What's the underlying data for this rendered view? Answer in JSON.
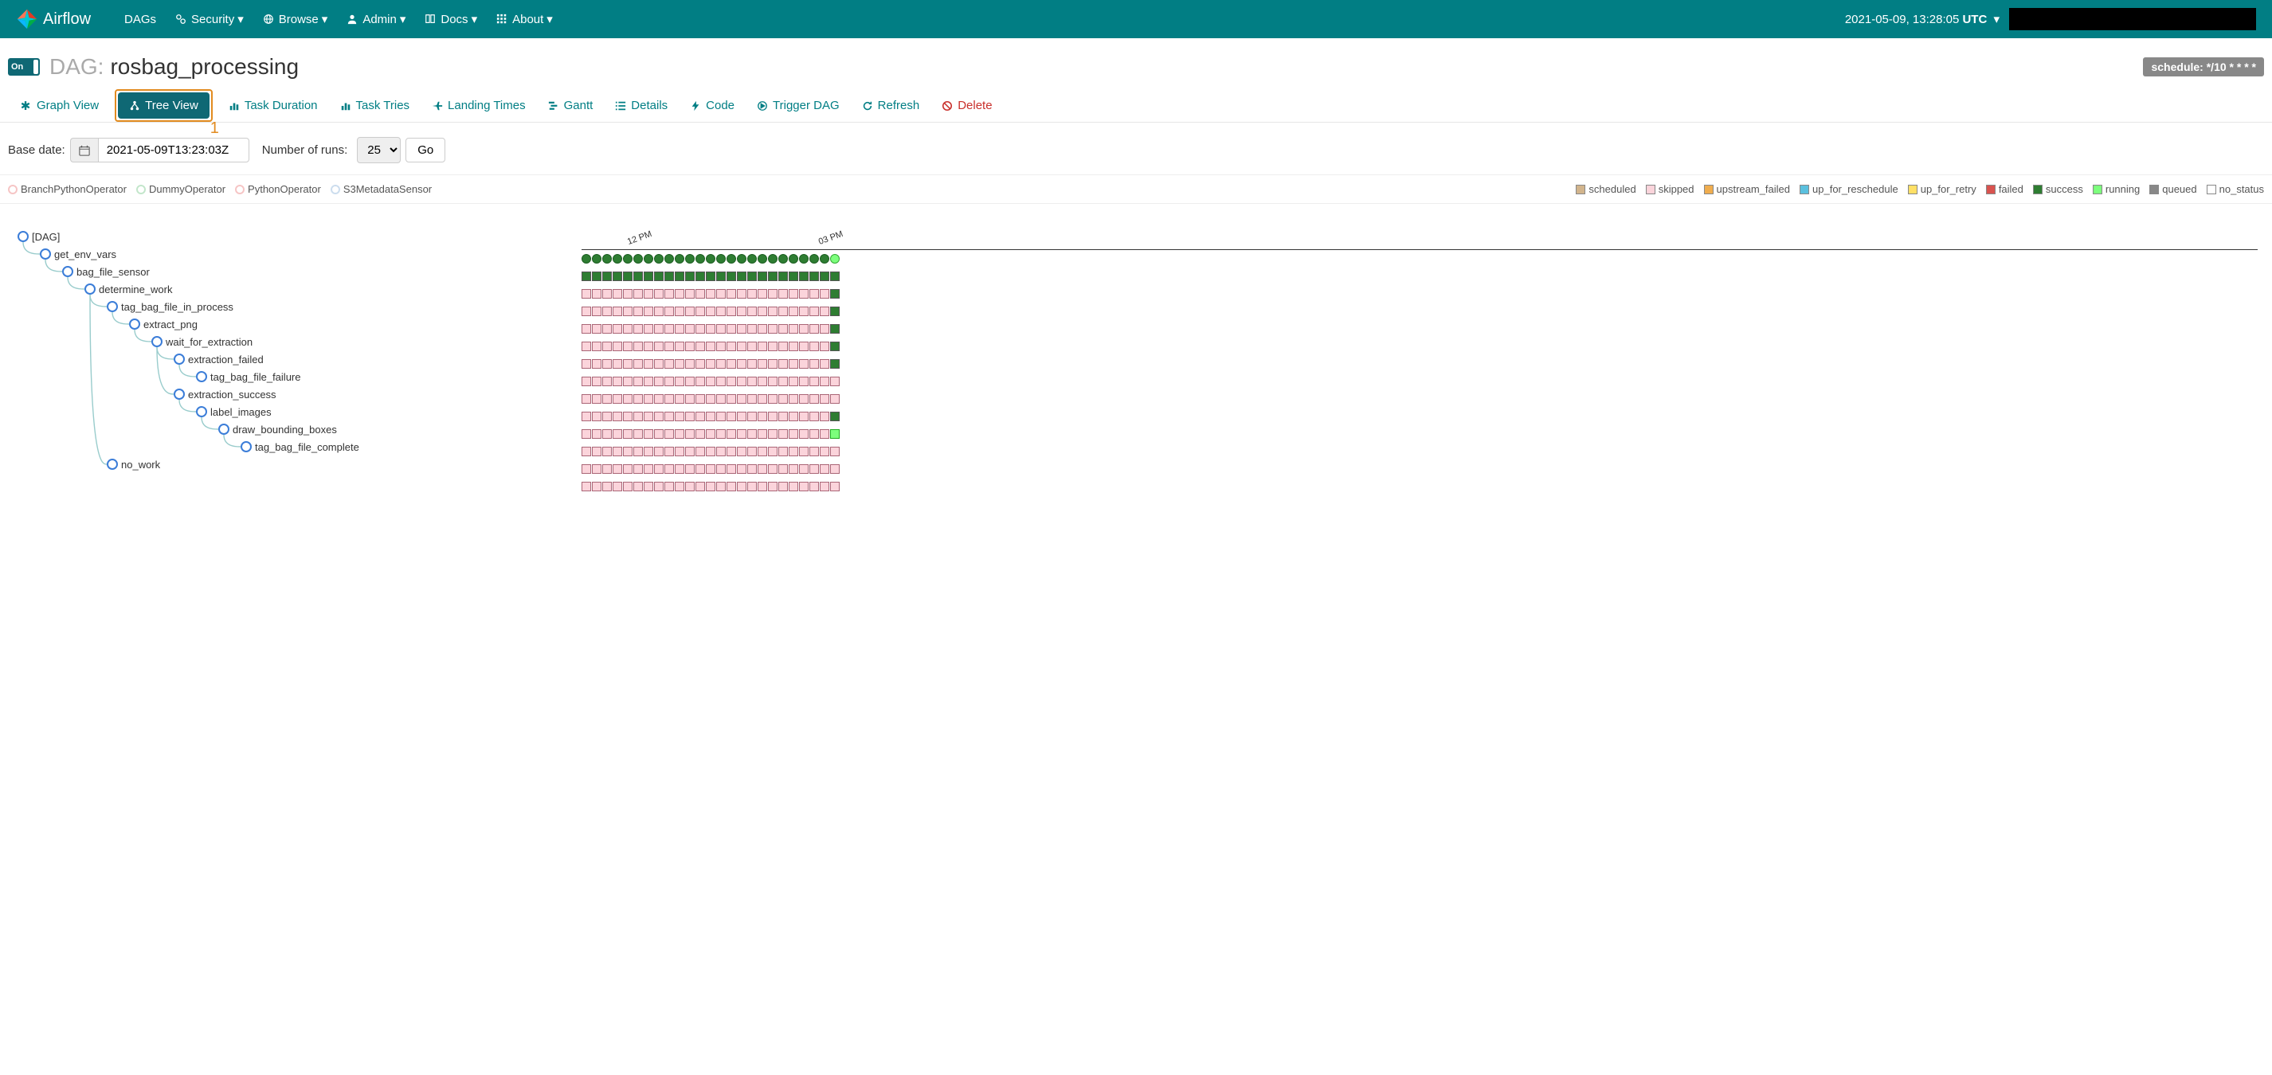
{
  "navbar": {
    "brand": "Airflow",
    "items": [
      {
        "label": "DAGs",
        "icon": null,
        "dropdown": false
      },
      {
        "label": "Security",
        "icon": "gears",
        "dropdown": true
      },
      {
        "label": "Browse",
        "icon": "globe",
        "dropdown": true
      },
      {
        "label": "Admin",
        "icon": "user",
        "dropdown": true
      },
      {
        "label": "Docs",
        "icon": "book",
        "dropdown": true
      },
      {
        "label": "About",
        "icon": "grid",
        "dropdown": true
      }
    ],
    "datetime": "2021-05-09, 13:28:05",
    "tz": "UTC"
  },
  "header": {
    "toggle_label": "On",
    "dag_label": "DAG:",
    "dag_name": "rosbag_processing",
    "schedule_label": "schedule: */10 * * * *"
  },
  "tabs": [
    {
      "key": "graph",
      "label": "Graph View",
      "icon": "✱",
      "active": false
    },
    {
      "key": "tree",
      "label": "Tree View",
      "icon": "tree",
      "active": true,
      "highlighted": true,
      "highlight_num": "1"
    },
    {
      "key": "duration",
      "label": "Task Duration",
      "icon": "bars",
      "active": false
    },
    {
      "key": "tries",
      "label": "Task Tries",
      "icon": "bars",
      "active": false
    },
    {
      "key": "landing",
      "label": "Landing Times",
      "icon": "plane",
      "active": false
    },
    {
      "key": "gantt",
      "label": "Gantt",
      "icon": "gantt",
      "active": false
    },
    {
      "key": "details",
      "label": "Details",
      "icon": "list",
      "active": false
    },
    {
      "key": "code",
      "label": "Code",
      "icon": "bolt",
      "active": false
    },
    {
      "key": "trigger",
      "label": "Trigger DAG",
      "icon": "play",
      "active": false
    },
    {
      "key": "refresh",
      "label": "Refresh",
      "icon": "refresh",
      "active": false
    },
    {
      "key": "delete",
      "label": "Delete",
      "icon": "ban",
      "active": false,
      "danger": true
    }
  ],
  "controls": {
    "base_date_label": "Base date:",
    "base_date_value": "2021-05-09T13:23:03Z",
    "num_runs_label": "Number of runs:",
    "num_runs_value": "25",
    "go_label": "Go"
  },
  "operator_legend": [
    {
      "name": "BranchPythonOperator",
      "color": "#f6c5c5"
    },
    {
      "name": "DummyOperator",
      "color": "#c3e6cb"
    },
    {
      "name": "PythonOperator",
      "color": "#f6c5c5"
    },
    {
      "name": "S3MetadataSensor",
      "color": "#cde"
    }
  ],
  "status_legend": [
    {
      "name": "scheduled",
      "color": "#d2b48c"
    },
    {
      "name": "skipped",
      "color": "#fbd4db"
    },
    {
      "name": "upstream_failed",
      "color": "#f0ad4e"
    },
    {
      "name": "up_for_reschedule",
      "color": "#5bc0de"
    },
    {
      "name": "up_for_retry",
      "color": "#ffe066"
    },
    {
      "name": "failed",
      "color": "#d9534f"
    },
    {
      "name": "success",
      "color": "#2e7d32"
    },
    {
      "name": "running",
      "color": "#7dff7d"
    },
    {
      "name": "queued",
      "color": "#888"
    },
    {
      "name": "no_status",
      "color": "#fff"
    }
  ],
  "tree": [
    {
      "name": "[DAG]",
      "depth": 0
    },
    {
      "name": "get_env_vars",
      "depth": 1
    },
    {
      "name": "bag_file_sensor",
      "depth": 2
    },
    {
      "name": "determine_work",
      "depth": 3
    },
    {
      "name": "tag_bag_file_in_process",
      "depth": 4
    },
    {
      "name": "extract_png",
      "depth": 5
    },
    {
      "name": "wait_for_extraction",
      "depth": 6
    },
    {
      "name": "extraction_failed",
      "depth": 7
    },
    {
      "name": "tag_bag_file_failure",
      "depth": 8
    },
    {
      "name": "extraction_success",
      "depth": 7
    },
    {
      "name": "label_images",
      "depth": 8
    },
    {
      "name": "draw_bounding_boxes",
      "depth": 9
    },
    {
      "name": "tag_bag_file_complete",
      "depth": 10
    },
    {
      "name": "no_work",
      "depth": 4
    }
  ],
  "timeline": {
    "ticks": [
      "12 PM",
      "03 PM"
    ],
    "num_runs": 25,
    "dag_row_last_running": true,
    "task_rows": [
      {
        "pattern": "all_success_last_success"
      },
      {
        "pattern": "all_skipped_last_success"
      },
      {
        "pattern": "all_skipped_last_success"
      },
      {
        "pattern": "all_skipped_last_success"
      },
      {
        "pattern": "all_skipped_last_success"
      },
      {
        "pattern": "all_skipped_last_success"
      },
      {
        "pattern": "all_skipped_last_skipped"
      },
      {
        "pattern": "all_skipped_last_skipped"
      },
      {
        "pattern": "all_skipped_last_success"
      },
      {
        "pattern": "all_skipped_last_running"
      },
      {
        "pattern": "all_skipped_last_skipped"
      },
      {
        "pattern": "all_skipped_last_skipped"
      },
      {
        "pattern": "all_skipped_last_skipped"
      }
    ]
  }
}
